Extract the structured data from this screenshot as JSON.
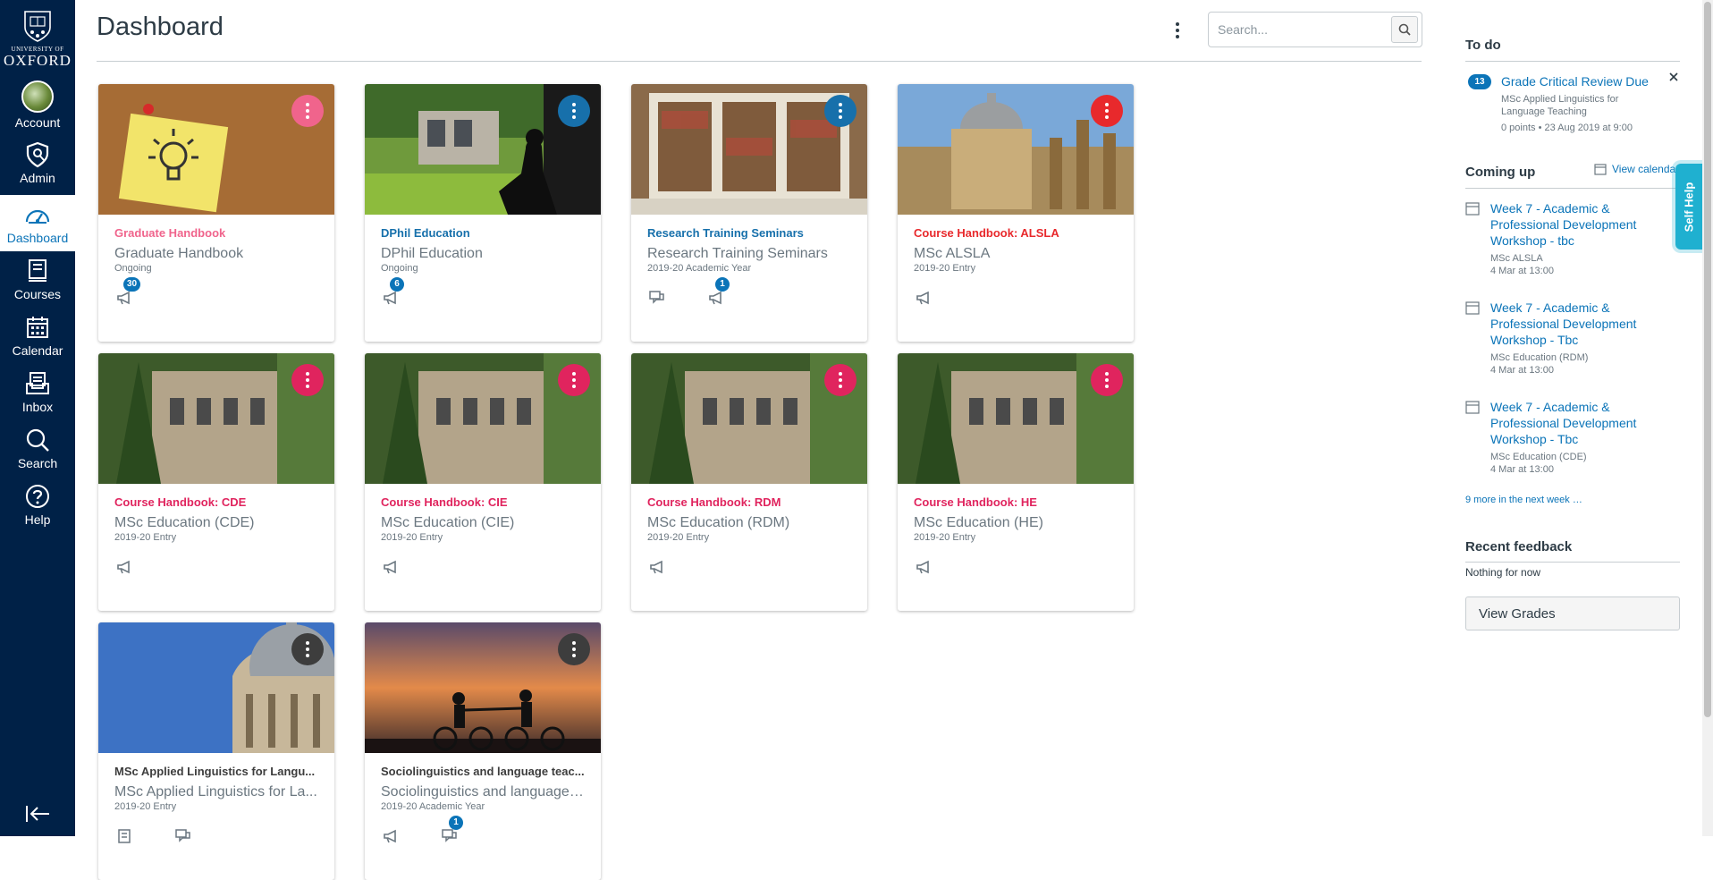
{
  "colors": {
    "nav_bg": "#002147",
    "link": "#0b74b8",
    "badge": "#0b74b8"
  },
  "nav": {
    "logo_top": "UNIVERSITY OF",
    "logo_bottom": "OXFORD",
    "items": [
      {
        "label": "Account",
        "icon": "avatar"
      },
      {
        "label": "Admin",
        "icon": "shield-icon"
      },
      {
        "label": "Dashboard",
        "icon": "dashboard-icon"
      },
      {
        "label": "Courses",
        "icon": "book-icon"
      },
      {
        "label": "Calendar",
        "icon": "calendar-icon"
      },
      {
        "label": "Inbox",
        "icon": "inbox-icon"
      },
      {
        "label": "Search",
        "icon": "search-icon"
      },
      {
        "label": "Help",
        "icon": "help-icon"
      }
    ]
  },
  "header": {
    "title": "Dashboard",
    "search_placeholder": "Search..."
  },
  "cards": [
    {
      "title": "Graduate Handbook",
      "subtitle": "Graduate Handbook",
      "term": "Ongoing",
      "color": "#f0648c",
      "badges": [
        "30"
      ]
    },
    {
      "title": "DPhil Education",
      "subtitle": "DPhil Education",
      "term": "Ongoing",
      "color": "#1770ab",
      "badges": [
        "6"
      ]
    },
    {
      "title": "Research Training Seminars",
      "subtitle": "Research Training Seminars",
      "term": "2019-20 Academic Year",
      "color": "#1770ab",
      "badges": [
        "",
        "1"
      ]
    },
    {
      "title": "Course Handbook: ALSLA",
      "subtitle": "MSc ALSLA",
      "term": "2019-20 Entry",
      "color": "#e8292c",
      "badges": [
        ""
      ]
    },
    {
      "title": "Course Handbook: CDE",
      "subtitle": "MSc Education (CDE)",
      "term": "2019-20 Entry",
      "color": "#e0245e"
    },
    {
      "title": "Course Handbook: CIE",
      "subtitle": "MSc Education (CIE)",
      "term": "2019-20 Entry",
      "color": "#e0245e"
    },
    {
      "title": "Course Handbook: RDM",
      "subtitle": "MSc Education (RDM)",
      "term": "2019-20 Entry",
      "color": "#e0245e"
    },
    {
      "title": "Course Handbook: HE",
      "subtitle": "MSc Education (HE)",
      "term": "2019-20 Entry",
      "color": "#e0245e"
    },
    {
      "title": "MSc Applied Linguistics for Langu...",
      "subtitle": "MSc Applied Linguistics for La...",
      "term": "2019-20 Entry",
      "color": "#3d3d3d"
    },
    {
      "title": "Sociolinguistics and language teac...",
      "subtitle": "Sociolinguistics and language t...",
      "term": "2019-20 Academic Year",
      "color": "#3d3d3d",
      "badges": [
        "",
        "1"
      ]
    }
  ],
  "todo": {
    "heading": "To do",
    "count": "13",
    "item_title": "Grade Critical Review Due",
    "item_course": "MSc Applied Linguistics for Language Teaching",
    "item_meta": "0 points • 23 Aug 2019 at 9:00"
  },
  "coming_up": {
    "heading": "Coming up",
    "view_calendar": "View calendar",
    "events": [
      {
        "title": "Week 7 - Academic & Professional Development Workshop - tbc",
        "course": "MSc ALSLA",
        "date": "4 Mar at 13:00"
      },
      {
        "title": "Week 7 - Academic & Professional Development Workshop - Tbc",
        "course": "MSc Education (RDM)",
        "date": "4 Mar at 13:00"
      },
      {
        "title": "Week 7 - Academic & Professional Development Workshop - Tbc",
        "course": "MSc Education (CDE)",
        "date": "4 Mar at 13:00"
      }
    ],
    "more": "9 more in the next week …"
  },
  "feedback": {
    "heading": "Recent feedback",
    "empty": "Nothing for now",
    "button": "View Grades"
  },
  "self_help": "Self Help"
}
